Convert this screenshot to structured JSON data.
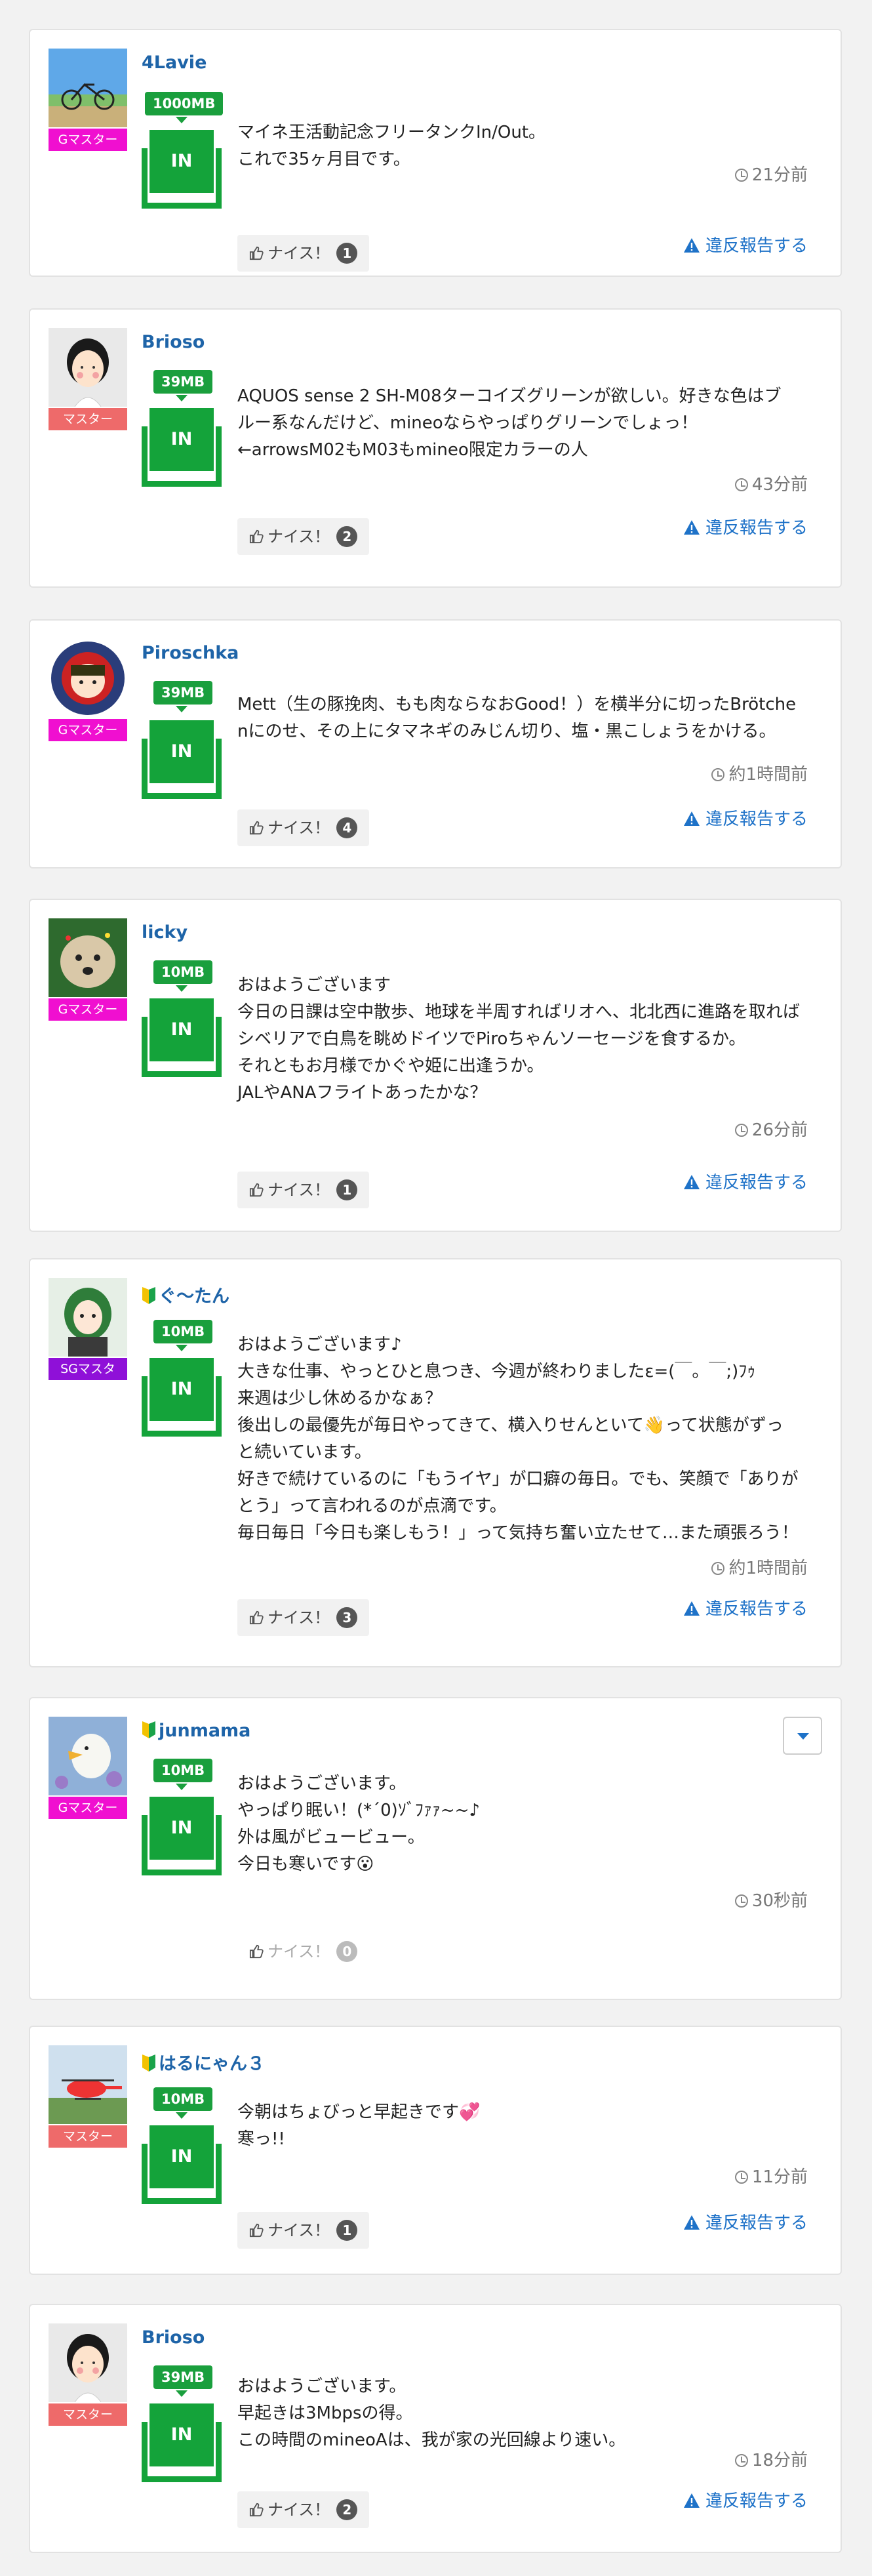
{
  "posts": [
    {
      "username": "4Lavie",
      "beginner": false,
      "rank": "Gマスター",
      "rank_color": "#f00fd0",
      "mb": "1000MB",
      "text": [
        "マイネ王活動記念フリータンクIn/Out。",
        "これで35ヶ月目です。"
      ],
      "time": "21分前",
      "nice_label": "ナイス！",
      "nice_count": "1",
      "report": "違反報告する",
      "avatar": "bicycle-photo"
    },
    {
      "username": "Brioso",
      "beginner": false,
      "rank": "マスター",
      "rank_color": "#ee6a6a",
      "mb": "39MB",
      "text": [
        "AQUOS sense 2 SH-M08ターコイズグリーンが欲しい。好きな色はブ",
        "ルー系なんだけど、mineoならやっぱりグリーンでしょっ！",
        "←arrowsM02もM03もmineo限定カラーの人"
      ],
      "time": "43分前",
      "nice_label": "ナイス！",
      "nice_count": "2",
      "report": "違反報告する",
      "avatar": "cartoon-woman"
    },
    {
      "username": "Piroschka",
      "beginner": false,
      "rank": "Gマスター",
      "rank_color": "#f00fd0",
      "mb": "39MB",
      "text": [
        "Mett（生の豚挽肉、もも肉ならなおGood！）を横半分に切ったBrötche",
        "nにのせ、その上にタマネギのみじん切り、塩・黒こしょうをかける。"
      ],
      "time": "約1時間前",
      "nice_label": "ナイス！",
      "nice_count": "4",
      "report": "違反報告する",
      "avatar": "red-hood-girl"
    },
    {
      "username": "licky",
      "beginner": false,
      "rank": "Gマスター",
      "rank_color": "#f00fd0",
      "mb": "10MB",
      "text": [
        "おはようございます",
        "今日の日課は空中散歩、地球を半周すればリオへ、北北西に進路を取れば",
        "シベリアで白鳥を眺めドイツでPiroちゃんソーセージを食するか。",
        "それともお月様でかぐや姫に出逢うか。",
        "JALやANAフライトあったかな？"
      ],
      "time": "26分前",
      "nice_label": "ナイス！",
      "nice_count": "1",
      "report": "違反報告する",
      "avatar": "dog-photo"
    },
    {
      "username": "ぐ〜たん",
      "beginner": true,
      "rank": "SGマスタ",
      "rank_color": "#8f10d8",
      "mb": "10MB",
      "text": [
        "おはようございます♪",
        "大きな仕事、やっとひと息つき、今週が終わりましたε=(￣。￣;)ﾌｩ",
        "来週は少し休めるかなぁ？",
        "後出しの最優先が毎日やってきて、横入りせんといて👋って状態がずっ",
        "と続いています。",
        "好きで続けているのに「もうイヤ」が口癖の毎日。でも、笑顔で「ありが",
        "とう」って言われるのが点滴です。",
        "毎日毎日「今日も楽しもう！」って気持ち奮い立たせて…また頑張ろう！"
      ],
      "time": "約1時間前",
      "nice_label": "ナイス！",
      "nice_count": "3",
      "report": "違反報告する",
      "avatar": "green-hair-girl"
    },
    {
      "username": "junmama",
      "beginner": true,
      "rank": "Gマスター",
      "rank_color": "#f00fd0",
      "mb": "10MB",
      "text": [
        "おはようございます。",
        "やっぱり眠い！(*´0)ｿﾞﾌｧｧ~~♪",
        "外は風がビュービュー。",
        "今日も寒いです😮"
      ],
      "time": "30秒前",
      "nice_label": "ナイス！",
      "nice_count": "0",
      "report": "",
      "avatar": "duck-photo"
    },
    {
      "username": "はるにゃん３",
      "beginner": true,
      "rank": "マスター",
      "rank_color": "#ee6a6a",
      "mb": "10MB",
      "text": [
        "今朝はちょびっと早起きです💞",
        "寒っ!!"
      ],
      "time": "11分前",
      "nice_label": "ナイス！",
      "nice_count": "1",
      "report": "違反報告する",
      "avatar": "helicopter-photo"
    },
    {
      "username": "Brioso",
      "beginner": false,
      "rank": "マスター",
      "rank_color": "#ee6a6a",
      "mb": "39MB",
      "text": [
        "おはようございます。",
        "早起きは3Mbpsの得。",
        "この時間のmineoAは、我が家の光回線より速い。"
      ],
      "time": "18分前",
      "nice_label": "ナイス！",
      "nice_count": "2",
      "report": "違反報告する",
      "avatar": "cartoon-woman"
    }
  ]
}
